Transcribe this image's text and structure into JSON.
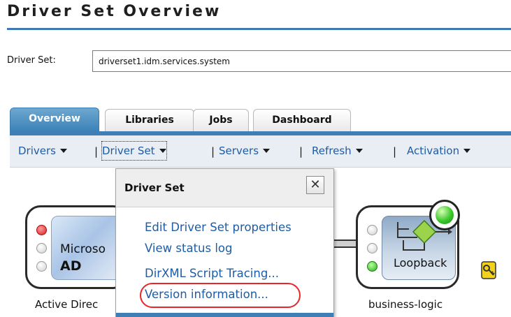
{
  "page": {
    "title": "Driver Set Overview"
  },
  "driver_set": {
    "label": "Driver Set:",
    "value": "driverset1.idm.services.system"
  },
  "tabs": [
    {
      "label": "Overview",
      "active": true
    },
    {
      "label": "Libraries",
      "active": false
    },
    {
      "label": "Jobs",
      "active": false
    },
    {
      "label": "Dashboard",
      "active": false
    }
  ],
  "menubar": {
    "items": [
      {
        "label": "Drivers",
        "has_dropdown": true
      },
      {
        "label": "Driver Set",
        "has_dropdown": true,
        "focused": true
      },
      {
        "label": "Servers",
        "has_dropdown": true
      },
      {
        "label": "Refresh",
        "has_dropdown": true
      },
      {
        "label": "Activation",
        "has_dropdown": true
      }
    ],
    "separator": "|"
  },
  "popup": {
    "title": "Driver Set",
    "close_icon": "close-icon",
    "links": [
      {
        "label": "Edit Driver Set properties"
      },
      {
        "label": "View status log"
      },
      {
        "label": "DirXML Script Tracing..."
      },
      {
        "label": "Version information...",
        "highlighted": true
      }
    ]
  },
  "drivers": [
    {
      "name": "Active Direc",
      "icon_text_1": "Microso",
      "icon_text_2": "AD",
      "status_leds": [
        "red",
        "off",
        "off"
      ]
    },
    {
      "name": "business-logic",
      "icon_text": "Loopback",
      "status_leds": [
        "off",
        "off",
        "green"
      ],
      "running_indicator": "green",
      "badge_icon": "key-icon"
    }
  ],
  "colors": {
    "accent_blue": "#3f7fb6",
    "link_blue": "#1e5ca6",
    "highlight_red": "#e8262a"
  }
}
